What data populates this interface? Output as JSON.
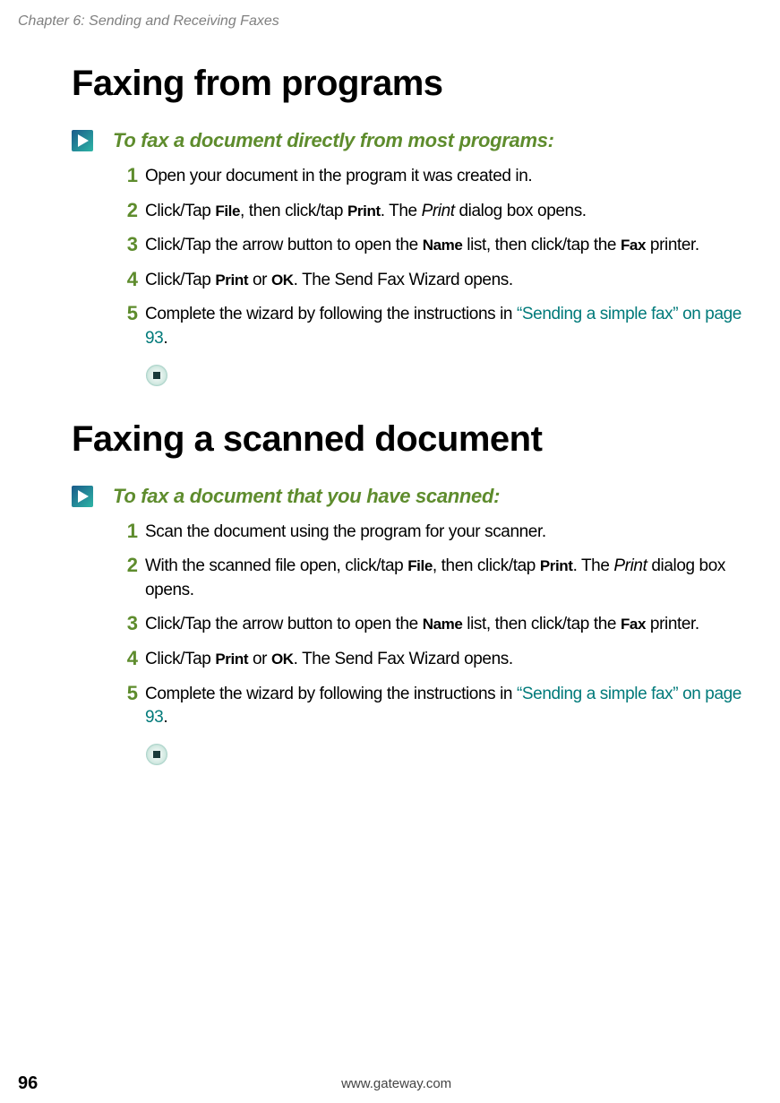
{
  "chapter_header": "Chapter 6: Sending and Receiving Faxes",
  "sections": [
    {
      "heading": "Faxing from programs",
      "procedure_title": "To fax a document directly from most programs:",
      "steps": [
        {
          "num": "1",
          "parts": [
            {
              "t": "plain",
              "v": "Open your document in the program it was created in."
            }
          ]
        },
        {
          "num": "2",
          "parts": [
            {
              "t": "plain",
              "v": "Click/Tap "
            },
            {
              "t": "bold",
              "v": "File"
            },
            {
              "t": "plain",
              "v": ", then click/tap "
            },
            {
              "t": "bold",
              "v": "Print"
            },
            {
              "t": "plain",
              "v": ". The "
            },
            {
              "t": "italic",
              "v": "Print"
            },
            {
              "t": "plain",
              "v": " dialog box opens."
            }
          ]
        },
        {
          "num": "3",
          "parts": [
            {
              "t": "plain",
              "v": "Click/Tap the arrow button to open the "
            },
            {
              "t": "bold",
              "v": "Name"
            },
            {
              "t": "plain",
              "v": " list, then click/tap the "
            },
            {
              "t": "bold",
              "v": "Fax"
            },
            {
              "t": "plain",
              "v": " printer."
            }
          ]
        },
        {
          "num": "4",
          "parts": [
            {
              "t": "plain",
              "v": "Click/Tap "
            },
            {
              "t": "bold",
              "v": "Print"
            },
            {
              "t": "plain",
              "v": " or "
            },
            {
              "t": "bold",
              "v": "OK"
            },
            {
              "t": "plain",
              "v": ". The Send Fax Wizard opens."
            }
          ]
        },
        {
          "num": "5",
          "parts": [
            {
              "t": "plain",
              "v": "Complete the wizard by following the instructions in "
            },
            {
              "t": "link",
              "v": "“Sending a simple fax” on page 93"
            },
            {
              "t": "plain",
              "v": "."
            }
          ]
        }
      ]
    },
    {
      "heading": "Faxing a scanned document",
      "procedure_title": "To fax a document that you have scanned:",
      "steps": [
        {
          "num": "1",
          "parts": [
            {
              "t": "plain",
              "v": "Scan the document using the program for your scanner."
            }
          ]
        },
        {
          "num": "2",
          "parts": [
            {
              "t": "plain",
              "v": "With the scanned file open, click/tap "
            },
            {
              "t": "bold",
              "v": "File"
            },
            {
              "t": "plain",
              "v": ", then click/tap "
            },
            {
              "t": "bold",
              "v": "Print"
            },
            {
              "t": "plain",
              "v": ". The "
            },
            {
              "t": "italic",
              "v": "Print"
            },
            {
              "t": "plain",
              "v": " dialog box opens."
            }
          ]
        },
        {
          "num": "3",
          "parts": [
            {
              "t": "plain",
              "v": "Click/Tap the arrow button to open the "
            },
            {
              "t": "bold",
              "v": "Name"
            },
            {
              "t": "plain",
              "v": " list, then click/tap the "
            },
            {
              "t": "bold",
              "v": "Fax"
            },
            {
              "t": "plain",
              "v": " printer."
            }
          ]
        },
        {
          "num": "4",
          "parts": [
            {
              "t": "plain",
              "v": "Click/Tap "
            },
            {
              "t": "bold",
              "v": "Print"
            },
            {
              "t": "plain",
              "v": " or "
            },
            {
              "t": "bold",
              "v": "OK"
            },
            {
              "t": "plain",
              "v": ". The Send Fax Wizard opens."
            }
          ]
        },
        {
          "num": "5",
          "parts": [
            {
              "t": "plain",
              "v": "Complete the wizard by following the instructions in "
            },
            {
              "t": "link",
              "v": "“Sending a simple fax” on page 93"
            },
            {
              "t": "plain",
              "v": "."
            }
          ]
        }
      ]
    }
  ],
  "footer": {
    "page_number": "96",
    "url": "www.gateway.com"
  }
}
